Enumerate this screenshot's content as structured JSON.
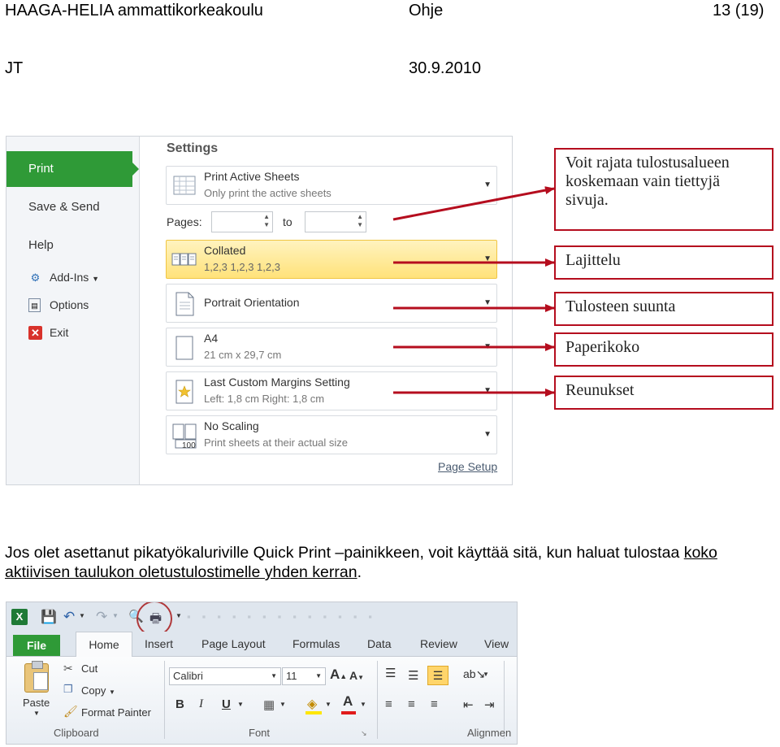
{
  "header": {
    "school": "HAAGA-HELIA ammattikorkeakoulu",
    "doc": "Ohje",
    "page": "13 (19)",
    "author": "JT",
    "date": "30.9.2010"
  },
  "backstage": {
    "nav": {
      "print": "Print",
      "save_send": "Save & Send",
      "help": "Help",
      "addins": "Add-Ins",
      "options": "Options",
      "exit": "Exit"
    },
    "settings_title": "Settings",
    "print_active": {
      "title": "Print Active Sheets",
      "sub": "Only print the active sheets"
    },
    "pages_label": "Pages:",
    "to_label": "to",
    "collated": {
      "title": "Collated",
      "sub": "1,2,3    1,2,3    1,2,3"
    },
    "orientation": {
      "title": "Portrait Orientation"
    },
    "paper": {
      "title": "A4",
      "sub": "21 cm x 29,7 cm"
    },
    "margins": {
      "title": "Last Custom Margins Setting",
      "sub": "Left:  1,8 cm    Right:  1,8 cm"
    },
    "scaling": {
      "title": "No Scaling",
      "sub": "Print sheets at their actual size",
      "icon_text": "100"
    },
    "page_setup": "Page Setup"
  },
  "callouts": {
    "area": "Voit rajata tulostusalueen koskemaan vain tiettyjä sivuja.",
    "collate": "Lajittelu",
    "orientation": "Tulosteen suunta",
    "paper": "Paperikoko",
    "margins": "Reunukset"
  },
  "paragraph": {
    "text": "Jos olet asettanut pikatyökaluriville Quick Print –painikkeen, voit käyttää sitä, kun haluat tulostaa ",
    "underlined": "koko aktiivisen taulukon oletustulostimelle yhden kerran",
    "end": "."
  },
  "ribbon": {
    "tabs": {
      "file": "File",
      "home": "Home",
      "insert": "Insert",
      "page_layout": "Page Layout",
      "formulas": "Formulas",
      "data": "Data",
      "review": "Review",
      "view": "View"
    },
    "paste": "Paste",
    "cut": "Cut",
    "copy": "Copy",
    "format_painter": "Format Painter",
    "font_name": "Calibri",
    "font_size": "11",
    "groups": {
      "clipboard": "Clipboard",
      "font": "Font",
      "alignment": "Alignmen"
    }
  },
  "colors": {
    "callout_border": "#b50d1e",
    "arrow": "#b50d1e",
    "office_green": "#2f9a37",
    "highlight": "#ffe27a"
  }
}
